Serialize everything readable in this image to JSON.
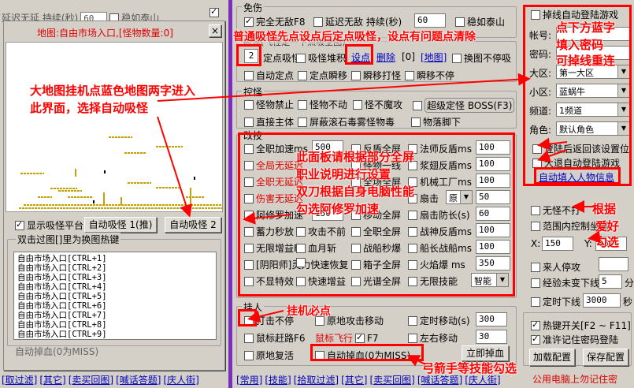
{
  "leftbg": {
    "top_items": [
      "延迟无延 持续(秒)",
      "60",
      "稳如泰山"
    ]
  },
  "map": {
    "title": "地图:自由市场入口,[怪物数量:0]",
    "close": "×",
    "show_platform": "显示吸怪平台",
    "auto_pull1": "自动吸怪 1(推)",
    "auto_pull2": "自动吸怪 2",
    "hotkey_title": "双击过图[]里为换图热键",
    "list": [
      "自由市场入口[CTRL+1]",
      "自由市场入口[CTRL+2]",
      "自由市场入口[CTRL+3]",
      "自由市场入口[CTRL+4]",
      "自由市场入口[CTRL+5]",
      "自由市场入口[CTRL+6]",
      "自由市场入口[CTRL+7]",
      "自由市场入口[CTRL+8]",
      "自由市场入口[CTRL+9]"
    ],
    "bottom": "自动掉血(0为MISS)",
    "bottom_btn": "立即掉血"
  },
  "leftlinks": [
    "[取过滤]",
    "[其它]",
    "[卖买回图]",
    "[喊话答题]",
    "[庆人街]"
  ],
  "mid": {
    "invincible": {
      "legend": "免伤",
      "full": "完全无敌F8",
      "delay": "延迟无敌 持续(秒)",
      "delay_val": "60",
      "steady": "稳如泰山"
    },
    "suck": {
      "legend": "吸怪(飞怪定一下点吸全图)",
      "num": "2",
      "fix": "定点吸怪",
      "stack": "吸怪堆积",
      "setpt": "设点",
      "del": "删除",
      "zero": "[0]",
      "map": "[地图]",
      "nomove": "换图不停吸",
      "autofix": "自动定点",
      "fixinst": "定点瞬移",
      "blink": "瞬移打怪",
      "blinkstop": "瞬移不停"
    },
    "ctrl": {
      "legend": "控怪",
      "ban": "怪物禁止",
      "still": "怪物不动",
      "nodemon": "怪不魔攻",
      "superboss": "超级定怪 BOSS(F3)",
      "direct": "直接主体",
      "shield": "屏蔽滚石毒雾怪物毒",
      "mobfeet": "物落脚下"
    },
    "skill": {
      "legend": "改技",
      "rows": [
        [
          "全职加速ms",
          "500",
          "反盾全屏",
          "法师反盾ms",
          "100"
        ],
        [
          "全局无延迟",
          "",
          "怪物一线",
          "浆翅反盾ms",
          "100"
        ],
        [
          "全职无延迟",
          "",
          "全场全屏",
          "机械工厂ms",
          "100"
        ],
        [
          "伤害无延迟",
          "",
          "",
          "扇击",
          "原",
          "50"
        ],
        [
          "阿修罗加速",
          "150",
          "移动全屏",
          "扇击防长(s)",
          "60"
        ],
        [
          "蓄力秒放",
          "攻击不前",
          "全职全屏",
          "战神反盾ms",
          "100"
        ],
        [
          "无限增益F5",
          "血月斩",
          "战船秒爆",
          "船长战船ms",
          "100"
        ],
        [
          "[阴阳师]灵力快速恢复",
          "",
          "箱子全屏",
          "火焰爆 ms",
          "350"
        ],
        [
          "不显特效",
          "快速增益",
          "光谱全屏",
          "无限技能",
          "智能"
        ]
      ]
    },
    "hang": {
      "legend": "挂人",
      "hitstop": "打击不停",
      "maphit": "原地攻击移动",
      "timemove": "定时移动(s)",
      "timemove_val": "300",
      "mousefly": "鼠标赶路F6",
      "mousefly2": "鼠标飞行",
      "f7": "F7",
      "lr": "左右移动",
      "lr_val": "30",
      "revive": "原地复活",
      "drop": "自动掉血(0为MISS)",
      "drop_btn": "立即掉血"
    }
  },
  "midlinks": [
    "[常用]",
    "[技能]",
    "[拾取过滤]",
    "[其它]",
    "[卖买回图]",
    "[喊话答题]",
    "[庆人街]"
  ],
  "right": {
    "relog": "掉线自动登陆游戏",
    "acct": "帐号:",
    "pwd": "密码:",
    "region": "大区:",
    "region_val": "第一大区",
    "sub": "小区:",
    "sub_val": "蓝蜗牛",
    "chan": "频道:",
    "chan_val": "1频道",
    "role": "角色:",
    "role_val": "默认角色",
    "back": "登陆后返回该设置位",
    "bigautolog": "大退自动登陆游戏",
    "autofill": "自动填入人物信息",
    "notbeyond": "无怪不打",
    "range": "范围内控制坐标",
    "x": "X:",
    "x_val": "150",
    "y": "Y:",
    "y_val": "150",
    "cometo": "来人停攻",
    "exp": "经验未变下线",
    "exp_val": "5",
    "exp_unit": "分",
    "timeoff": "定时下线",
    "timeoff_val": "3000",
    "timeoff_unit": "秒",
    "hotkey": "热键开关[F2 ~ F11]",
    "remember": "准许记住密码登陆",
    "load": "加载配置",
    "save": "保存配置",
    "warn": "公用电脑上勿记住密"
  },
  "annotations": {
    "a1": "普通吸怪先点设点后定点吸怪，设点有问题点清除",
    "a2": "大地图挂机点蓝色地图两字进入",
    "a3": "此界面，选择自动吸怪",
    "a4": "此面板请根据部分全屏",
    "a5": "职业说明进行设置",
    "a6": "双刀根据自身电脑性能",
    "a7": "勾选阿修罗加速",
    "a8": "挂机必点",
    "a9": "弓箭手等技能勾选",
    "a10": "点下方蓝字",
    "a11": "填入密码",
    "a12": "可掉线重连",
    "a13": "根据",
    "a14": "爱好",
    "a15": "勾选"
  },
  "colors": {
    "accent": "#ff0000",
    "purple": "#7b2fbe",
    "link": "#0000c0"
  }
}
